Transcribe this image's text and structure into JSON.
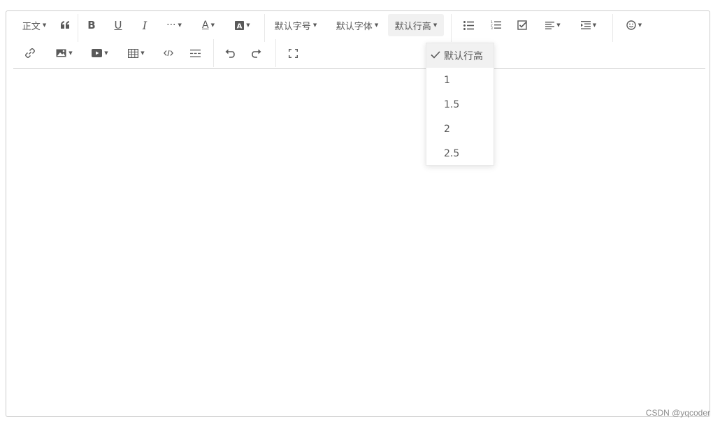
{
  "toolbar": {
    "paragraph_label": "正文",
    "font_size_label": "默认字号",
    "font_family_label": "默认字体",
    "line_height_label": "默认行高",
    "icons_row1": [
      "blockquote-icon",
      "bold-icon",
      "underline-icon",
      "italic-icon",
      "more-icon",
      "font-color-icon",
      "bg-color-icon",
      "bulleted-list-icon",
      "numbered-list-icon",
      "todo-icon",
      "justify-icon",
      "indent-icon",
      "emotion-icon"
    ],
    "icons_row2": [
      "link-icon",
      "image-icon",
      "video-icon",
      "table-icon",
      "code-block-icon",
      "divider-icon",
      "undo-icon",
      "redo-icon",
      "fullscreen-icon"
    ]
  },
  "line_height_menu": {
    "items": [
      {
        "label": "默认行高",
        "selected": true
      },
      {
        "label": "1",
        "selected": false
      },
      {
        "label": "1.5",
        "selected": false
      },
      {
        "label": "2",
        "selected": false
      },
      {
        "label": "2.5",
        "selected": false
      }
    ]
  },
  "watermark": "CSDN @yqcoder"
}
